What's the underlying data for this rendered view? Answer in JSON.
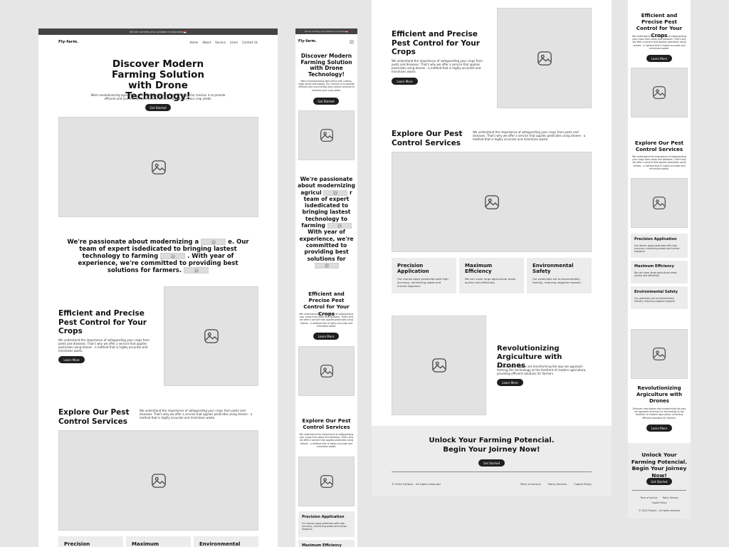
{
  "banner": "We are currently only available in Indonesia 🇮🇩",
  "logo": "Fly-farm.",
  "nav": [
    "Home",
    "About",
    "Service",
    "Learn",
    "Contact Us"
  ],
  "hero": {
    "title": "Discover Modern Farming Solution with Drone Technology!",
    "text": "Were revolutionizing agriculture with cutting-edge drone technology. Our mission is to provide efficient and eco-friendly pest control services to enhance your crop yields.",
    "cta": "Get Started"
  },
  "passion": {
    "p1": "We're passionate about modernizing",
    "p2": "a",
    "p3": "e. Our team of expert isdedicated to bringing lastest technology to farming",
    "p4": ". With year of experience, we're committed to providing best solutions for farmers."
  },
  "mobile_passion": {
    "a": "We're passionate about modernizing agricul",
    "b": "r team of expert isdedicated to bringing lastest technology to farming",
    "c": "With year of experience, we're committed to providing best solutions for"
  },
  "pest": {
    "title": "Efficient and Precise Pest Control for Your Crops",
    "text": "We understand the importance of safeguarding your crops from pests and diseases. That's why we offer a service that applies pesticides using drones - a method that is highly accurate and minimizes waste.",
    "cta": "Learn More"
  },
  "explore": {
    "title": "Explore Our Pest Control Services",
    "text": "We understand the importance of safeguarding your crops from pests and diseases. That's why we offer a service that applies pesticides using drones - a method that is highly accurate and minimizes waste."
  },
  "features": [
    {
      "title": "Precision Application",
      "text": "Our drones apply pesticides with high accuracy, minimizing waste and human exposure."
    },
    {
      "title": "Maximum Efficiency",
      "text": "We can cover large agricultural areas quickly and efficiently."
    },
    {
      "title": "Environmental Safety",
      "text": "Our pesticides are environmentally friendly, reducing negative impacts."
    }
  ],
  "revolution": {
    "title": "Revolutionizing Argiculture with Drones",
    "text": "Discover how drones are transforming the way we approach farming Our technology at the forefront of modern agriculture, providing efficient solutions for farmers.",
    "cta": "Learn More"
  },
  "cta_section": {
    "title": "Unlock Your Farming Potencial. Begin Your Joirney Now!",
    "cta": "Get Started"
  },
  "footer": {
    "copyright": "© 2024 Flyfarm - All rights reserved",
    "links": [
      "Term of service",
      "Policy Service",
      "Cookie Policy"
    ]
  }
}
